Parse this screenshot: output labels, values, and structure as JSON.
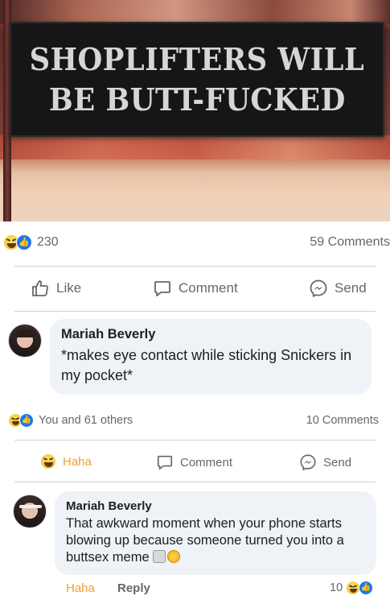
{
  "post": {
    "sign_line_1": "SHOPLIFTERS WILL",
    "sign_line_2": "BE BUTT-FUCKED",
    "reaction_count": "230",
    "comments_count": "59 Comments",
    "actions": {
      "like": "Like",
      "comment": "Comment",
      "send": "Send"
    }
  },
  "comment1": {
    "author": "Mariah Beverly",
    "text": "*makes eye contact while sticking Snickers in my pocket*"
  },
  "comment1_stats": {
    "reactions": "You and 61 others",
    "comments": "10 Comments"
  },
  "comment1_actions": {
    "haha": "Haha",
    "comment": "Comment",
    "send": "Send"
  },
  "reply": {
    "author": "Mariah Beverly",
    "text": "That awkward moment when your phone starts blowing up because someone turned you into a buttsex meme",
    "actions": {
      "haha": "Haha",
      "reply": "Reply"
    },
    "reaction_count": "10"
  },
  "colors": {
    "facebook_blue": "#1877f2",
    "haha_orange": "#f0a030",
    "bubble_grey": "#eff2f6"
  },
  "icons": [
    "haha-emoji",
    "like-emoji",
    "thumbs-up-icon",
    "comment-icon",
    "messenger-icon",
    "scream-emoji",
    "laughing-emoji"
  ]
}
